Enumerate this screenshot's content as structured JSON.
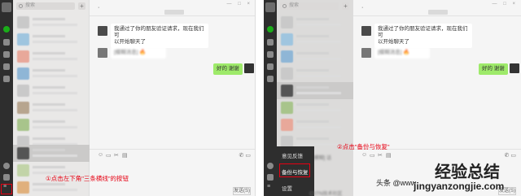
{
  "left": {
    "search": {
      "placeholder": "搜索"
    },
    "plus_label": "+",
    "window_controls": "— □ ×",
    "chat_title": "·",
    "timestamp": " ",
    "incoming": {
      "line1": "我通过了你的朋友验证请求，现在我们可",
      "line2": "以开始聊天了"
    },
    "blurred_msg": "[模糊消息] 🔥",
    "outgoing": "好的 谢谢",
    "toolbar_icons": [
      "emoji-icon",
      "folder-icon",
      "scissors-icon",
      "chat-history-icon"
    ],
    "toolbar_glyphs": [
      "☺",
      "▭",
      "✂",
      "▤"
    ],
    "call_icons": "✆ ▭",
    "send_label": "发送(S)",
    "annotation": "①点击左下角\"三条横线\"的按钮"
  },
  "right": {
    "search": {
      "placeholder": "搜索"
    },
    "plus_label": "+",
    "window_controls": "— □ ×",
    "chat_title": "·",
    "incoming": {
      "line1": "我通过了你的朋友验证请求，现在我们可",
      "line2": "以开始聊天了"
    },
    "blurred_msg": "[模糊消息] 🔥",
    "outgoing": "好的 谢谢",
    "annotation": "②点击\"备份与恢复\"",
    "menu": [
      "意见反馈",
      "备份与恢复",
      "设置"
    ],
    "menu_side_hint": "[模糊] 话",
    "toolbar_glyphs": [
      "☺",
      "▭",
      "✂",
      "▤"
    ],
    "call_icons": "✆ ▭",
    "send_label": "发送(S)",
    "bottom_blur": "CSTN技术社区"
  },
  "watermark": {
    "small": "头条 @www",
    "brand": "经验总结",
    "url": "jingyanzongjie.com"
  },
  "colors": {
    "accent_red": "#e60012",
    "bubble_green": "#9eea6a",
    "rail": "#2e2e2e",
    "wechat_green": "#1aad19"
  }
}
